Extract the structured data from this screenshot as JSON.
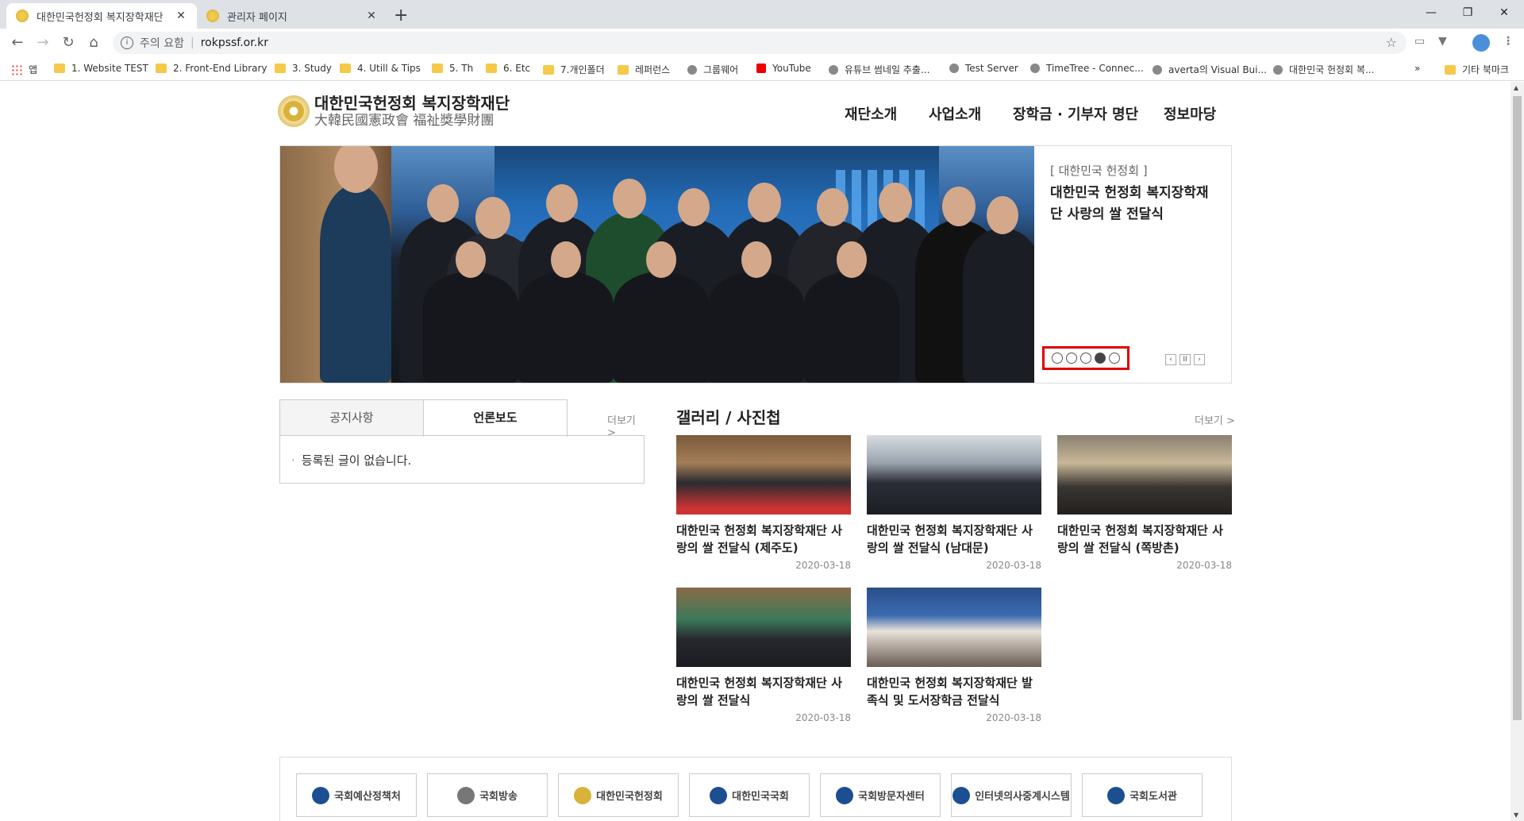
{
  "browser": {
    "tabs": [
      {
        "title": "대한민국헌정회 복지장학재단",
        "close": "✕"
      },
      {
        "title": "관리자 페이지",
        "close": "✕"
      }
    ],
    "new_tab": "+",
    "window_controls": {
      "minimize": "—",
      "restore": "❐",
      "close": "✕"
    },
    "address": {
      "security_label": "주의 요함",
      "url": "rokpssf.or.kr"
    },
    "bookmarks": [
      {
        "label": "앱",
        "type": "apps"
      },
      {
        "label": "1. Website TEST",
        "type": "folder"
      },
      {
        "label": "2. Front-End Library",
        "type": "folder"
      },
      {
        "label": "3. Study",
        "type": "folder"
      },
      {
        "label": "4. Utill & Tips",
        "type": "folder"
      },
      {
        "label": "5. Th",
        "type": "folder"
      },
      {
        "label": "6. Etc",
        "type": "folder"
      },
      {
        "label": "7.개인폴더",
        "type": "folder"
      },
      {
        "label": "레퍼런스",
        "type": "folder"
      },
      {
        "label": "그룹웨어",
        "type": "site"
      },
      {
        "label": "YouTube",
        "type": "youtube"
      },
      {
        "label": "유튜브 썸네일 추출...",
        "type": "site"
      },
      {
        "label": "Test Server",
        "type": "site"
      },
      {
        "label": "TimeTree - Connec...",
        "type": "site"
      },
      {
        "label": "averta의 Visual Bui...",
        "type": "site"
      },
      {
        "label": "대한민국 헌정회 복...",
        "type": "site"
      },
      {
        "label": "»",
        "type": "overflow"
      },
      {
        "label": "기타 북마크",
        "type": "folder"
      }
    ]
  },
  "site": {
    "logo": {
      "name_ko": "대한민국헌정회 복지장학재단",
      "name_hanja": "大韓民國憲政會 福祉獎學財團"
    },
    "nav": [
      "재단소개",
      "사업소개",
      "장학금 · 기부자 명단",
      "정보마당"
    ],
    "hero": {
      "category": "[ 대한민국 헌정회 ]",
      "headline": "대한민국 헌정회 복지장학재단 사랑의 쌀 전달식",
      "slide_count": 5,
      "active_slide": 4,
      "controls": {
        "prev": "‹",
        "pause": "II",
        "next": "›"
      }
    },
    "board": {
      "tabs": [
        "공지사항",
        "언론보도"
      ],
      "active_tab": "언론보도",
      "more": "더보기 >",
      "empty_message": "등록된 글이 없습니다."
    },
    "gallery": {
      "title": "갤러리 / 사진첩",
      "more": "더보기 >",
      "items": [
        {
          "title": "대한민국 헌정회 복지장학재단 사랑의 쌀 전달식 (제주도)",
          "date": "2020-03-18"
        },
        {
          "title": "대한민국 헌정회 복지장학재단 사랑의 쌀 전달식 (남대문)",
          "date": "2020-03-18"
        },
        {
          "title": "대한민국 헌정회 복지장학재단 사랑의 쌀 전달식 (쪽방촌)",
          "date": "2020-03-18"
        },
        {
          "title": "대한민국 헌정회 복지장학재단 사랑의 쌀 전달식",
          "date": "2020-03-18"
        },
        {
          "title": "대한민국 헌정회 복지장학재단 발족식 및 도서장학금 전달식",
          "date": "2020-03-18"
        }
      ]
    },
    "partners": [
      "국회예산정책처",
      "국회방송",
      "대한민국헌정회",
      "대한민국국회",
      "국회방문자센터",
      "인터넷의사중계시스템",
      "국회도서관"
    ],
    "colors": {
      "highlight": "#e00000",
      "tab_bg": "#dee1e6"
    }
  }
}
